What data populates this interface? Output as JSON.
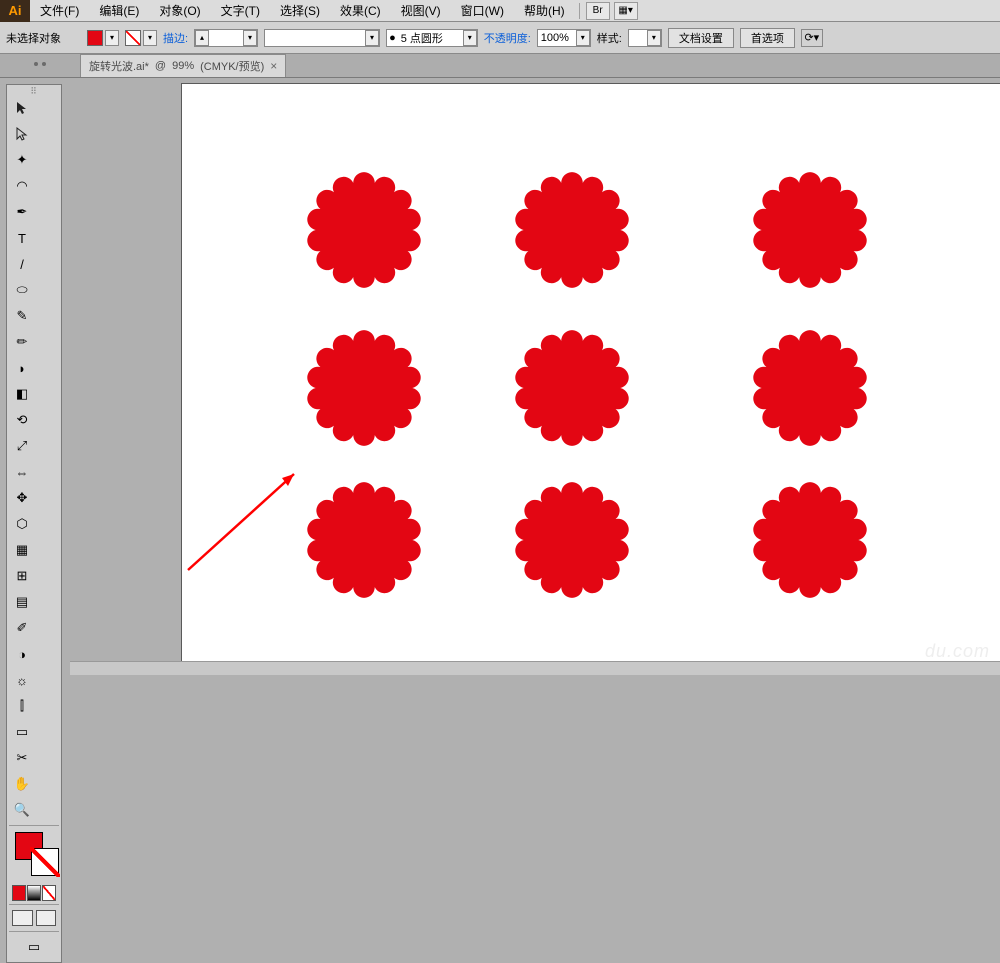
{
  "app": {
    "logo_text": "Ai"
  },
  "menu": {
    "file": "文件(F)",
    "edit": "编辑(E)",
    "object": "对象(O)",
    "type": "文字(T)",
    "select": "选择(S)",
    "effect": "效果(C)",
    "view": "视图(V)",
    "window": "窗口(W)",
    "help": "帮助(H)",
    "bridge_abbr": "Br"
  },
  "control": {
    "no_selection": "未选择对象",
    "stroke_label": "描边:",
    "stroke_value": "",
    "brush_value": "",
    "variable_width_value": "5 点圆形",
    "opacity_label": "不透明度:",
    "opacity_value": "100%",
    "style_label": "样式:",
    "doc_setup": "文档设置",
    "preferences": "首选项"
  },
  "tab": {
    "name": "旋转光波.ai*",
    "zoom": "99%",
    "mode": "(CMYK/预览)",
    "close": "×"
  },
  "tools": {
    "selection": "▲",
    "direct": "▲",
    "magic": "✦",
    "lasso": "◠",
    "pen": "✒",
    "type": "T",
    "line": "/",
    "rect": "⬭",
    "brush": "✎",
    "pencil": "✏",
    "blob": "◗",
    "eraser": "◧",
    "rotate": "⟲",
    "scale": "⤢",
    "width": "⇔",
    "free": "✥",
    "shapebuilder": "⬡",
    "perspective": "▦",
    "mesh": "⊞",
    "gradient": "▤",
    "eyedrop": "✐",
    "blend": "◑",
    "symbol": "☼",
    "graph": "⫿",
    "artboard": "▭",
    "slice": "✂",
    "hand": "✋",
    "zoom": "🔍"
  },
  "canvas": {
    "shape_color": "#e30613",
    "arrow_color": "#ff0000",
    "watermark": "du.com"
  }
}
